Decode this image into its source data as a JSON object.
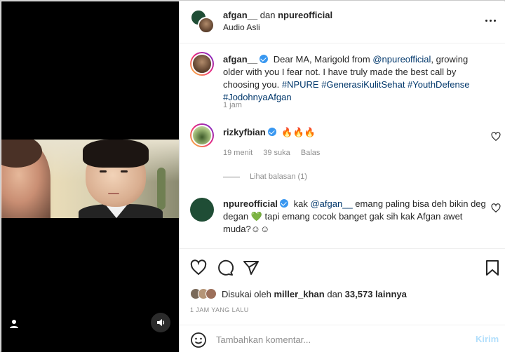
{
  "header": {
    "user1": "afgan__",
    "connector": "dan",
    "user2": "npureofficial",
    "audio": "Audio Asli"
  },
  "caption": {
    "user": "afgan__",
    "text_before": "Dear MA, Marigold from ",
    "mention": "@npureofficial",
    "text_after": ", growing older with you I fear not. I have truly made the best call by choosing you. ",
    "hashtags": "#NPURE #GenerasiKulitSehat #YouthDefense #JodohnyaAfgan",
    "time": "1 jam"
  },
  "comments": [
    {
      "user": "rizkyfbian",
      "text": "🔥🔥🔥",
      "time": "19 menit",
      "likes": "39 suka",
      "reply": "Balas",
      "view_replies": "Lihat balasan (1)"
    },
    {
      "user": "npureofficial",
      "text_before": "kak ",
      "mention": "@afgan__",
      "text_after": " emang paling bisa deh bikin deg degan 💚 tapi emang cocok banget gak sih kak Afgan awet muda?☺☺"
    }
  ],
  "likes": {
    "prefix": "Disukai oleh",
    "user": "miller_khan",
    "connector": "dan",
    "count": "33,573 lainnya"
  },
  "time_ago": "1 JAM YANG LALU",
  "add_comment": {
    "placeholder": "Tambahkan komentar...",
    "post": "Kirim"
  },
  "icons": [
    "heart-icon",
    "comment-icon",
    "share-icon",
    "bookmark-icon",
    "emoji-icon",
    "sound-icon",
    "user-tag-icon",
    "more-icon"
  ],
  "colors": {
    "link": "#00376b",
    "verified": "#3897f0",
    "post_disabled": "#b2dffc",
    "muted": "#8e8e8e"
  }
}
